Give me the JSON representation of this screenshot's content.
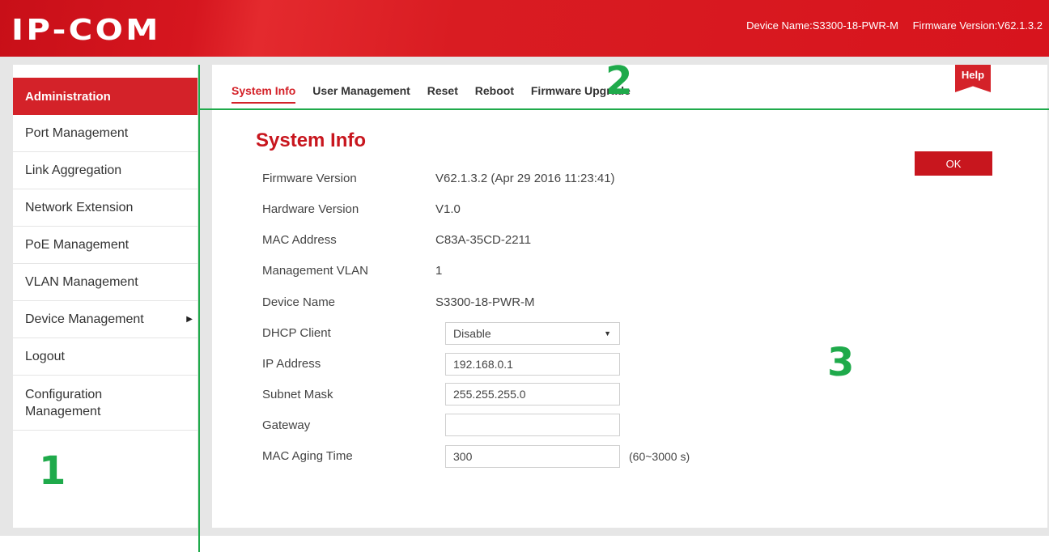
{
  "header": {
    "logo": "IP-COM",
    "device_name": "Device Name:S3300-18-PWR-M",
    "firmware_version": "Firmware Version:V62.1.3.2"
  },
  "sidebar": {
    "items": [
      {
        "label": "Administration",
        "active": true
      },
      {
        "label": "Port Management"
      },
      {
        "label": "Link Aggregation"
      },
      {
        "label": "Network Extension"
      },
      {
        "label": "PoE Management"
      },
      {
        "label": "VLAN Management"
      },
      {
        "label": "Device Management",
        "has_submenu": true,
        "icon": "triangle-right-icon"
      },
      {
        "label": "Logout"
      },
      {
        "label_line1": "Configuration",
        "label_line2": "Management"
      }
    ]
  },
  "tabs": [
    {
      "label": "System Info",
      "active": true
    },
    {
      "label": "User Management"
    },
    {
      "label": "Reset"
    },
    {
      "label": "Reboot"
    },
    {
      "label": "Firmware Upgrade"
    }
  ],
  "help_label": "Help",
  "page_title": "System Info",
  "ok_label": "OK",
  "system_info": {
    "firmware_version": {
      "label": "Firmware Version",
      "value": "V62.1.3.2 (Apr 29 2016 11:23:41)"
    },
    "hardware_version": {
      "label": "Hardware Version",
      "value": "V1.0"
    },
    "mac_address": {
      "label": "MAC Address",
      "value": "C83A-35CD-2211"
    },
    "management_vlan": {
      "label": "Management VLAN",
      "value": "1"
    },
    "device_name": {
      "label": "Device Name",
      "value": "S3300-18-PWR-M"
    },
    "dhcp_client": {
      "label": "DHCP Client",
      "value": "Disable"
    },
    "ip_address": {
      "label": "IP Address",
      "value": "192.168.0.1"
    },
    "subnet_mask": {
      "label": "Subnet Mask",
      "value": "255.255.255.0"
    },
    "gateway": {
      "label": "Gateway",
      "value": ""
    },
    "mac_aging_time": {
      "label": "MAC Aging Time",
      "value": "300",
      "hint": "(60~3000 s)"
    }
  },
  "annotations": {
    "one": "1",
    "two": "2",
    "three": "3"
  },
  "colors": {
    "brand_red": "#d42229",
    "annotation_green": "#1faa4b",
    "frame_gray": "#e6e6e6"
  }
}
